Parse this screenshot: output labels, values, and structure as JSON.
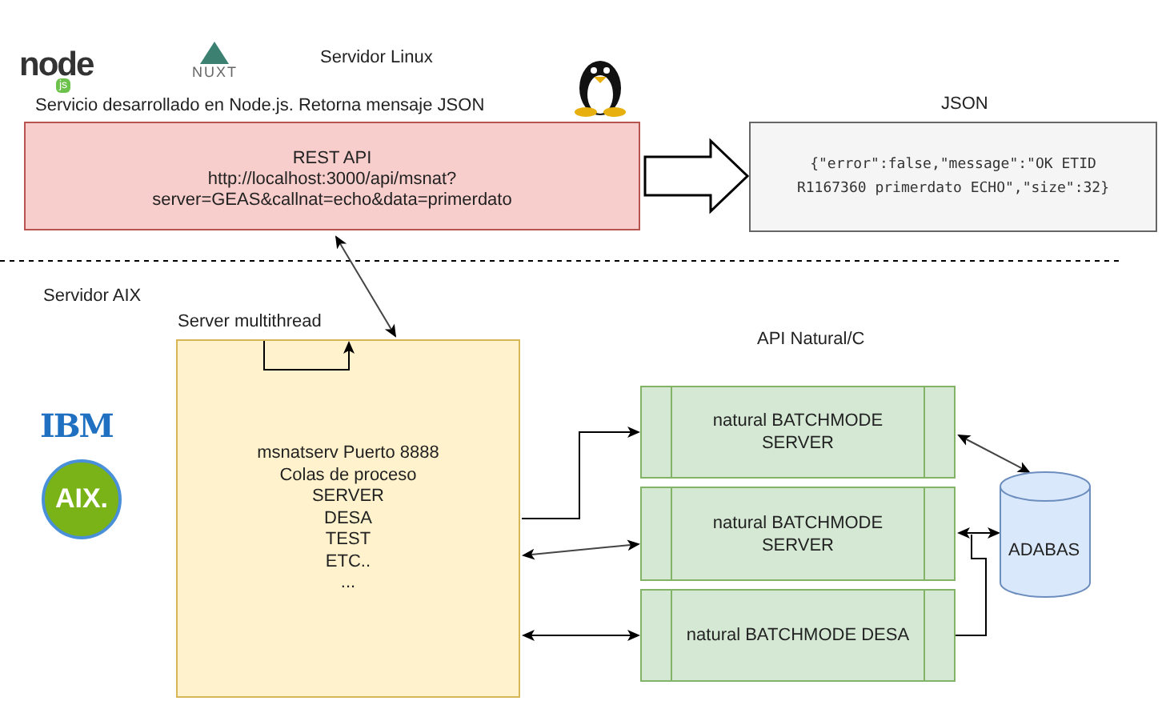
{
  "linux_server": {
    "label": "Servidor Linux",
    "description": "Servicio desarrollado en Node.js. Retorna mensaje JSON",
    "logos": [
      {
        "kind": "node",
        "word": "node",
        "badge": "js"
      },
      {
        "kind": "nuxt",
        "word": "NUXT"
      }
    ]
  },
  "rest_api": {
    "lines": [
      "REST API",
      "http://localhost:3000/api/msnat?",
      "server=GEAS&callnat=echo&data=primerdato"
    ]
  },
  "json_output": {
    "label": "JSON",
    "lines": [
      "{\"error\":false,\"message\":\"OK ETID",
      "R1167360 primerdato ECHO\",\"size\":32}"
    ]
  },
  "aix_server": {
    "label": "Servidor AIX",
    "logos": [
      {
        "kind": "ibm",
        "word": "IBM"
      },
      {
        "kind": "aix",
        "word": "AIX."
      }
    ],
    "thread_label": "Server multithread",
    "daemon_lines": [
      "msnatserv Puerto 8888",
      "Colas de proceso",
      "SERVER",
      "DESA",
      "TEST",
      "ETC..",
      "..."
    ],
    "api_label": "API Natural/C",
    "processes": [
      {
        "lines": [
          "natural BATCHMODE",
          "SERVER"
        ]
      },
      {
        "lines": [
          "natural BATCHMODE",
          "SERVER"
        ]
      },
      {
        "lines": [
          "natural BATCHMODE DESA"
        ]
      }
    ],
    "database": "ADABAS"
  }
}
